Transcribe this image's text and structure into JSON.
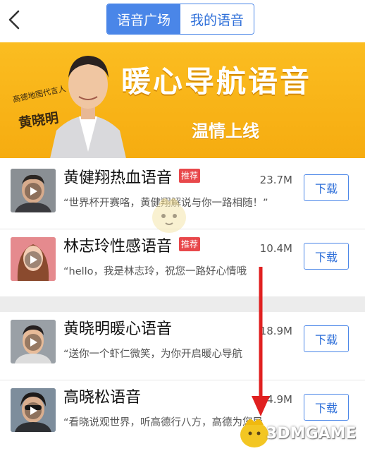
{
  "header": {
    "tabs": [
      {
        "label": "语音广场",
        "active": true
      },
      {
        "label": "我的语音",
        "active": false
      }
    ]
  },
  "banner": {
    "subtitle": "高德地图代言人",
    "name": "黄晓明",
    "title": "暖心导航语音",
    "tagline": "温情上线"
  },
  "voices": [
    {
      "title": "黄健翔热血语音",
      "badge": "推荐",
      "desc": "“世界杯开赛咯，黄健翔解说与你一路相随！”",
      "size": "23.7M",
      "button": "下载",
      "avatar_bg": "#8a8f94"
    },
    {
      "title": "林志玲性感语音",
      "badge": "推荐",
      "desc": "“hello，我是林志玲，祝您一路好心情哦",
      "size": "10.4M",
      "button": "下载",
      "avatar_bg": "#e58a8e"
    },
    {
      "title": "黄晓明暖心语音",
      "badge": "",
      "desc": "“送你一个虾仁微笑，为你开启暖心导航",
      "size": "18.9M",
      "button": "下载",
      "avatar_bg": "#9aa0a6"
    },
    {
      "title": "高晓松语音",
      "badge": "",
      "desc": "“看晓说观世界，听高德行八方，高德为您导",
      "size": "4.9M",
      "button": "下载",
      "avatar_bg": "#7d8d9c"
    }
  ],
  "watermark": "3DMGAME",
  "colors": {
    "accent": "#4a86e8",
    "banner": "#fbb21a",
    "badge": "#e8484b",
    "arrow": "#e02020"
  }
}
